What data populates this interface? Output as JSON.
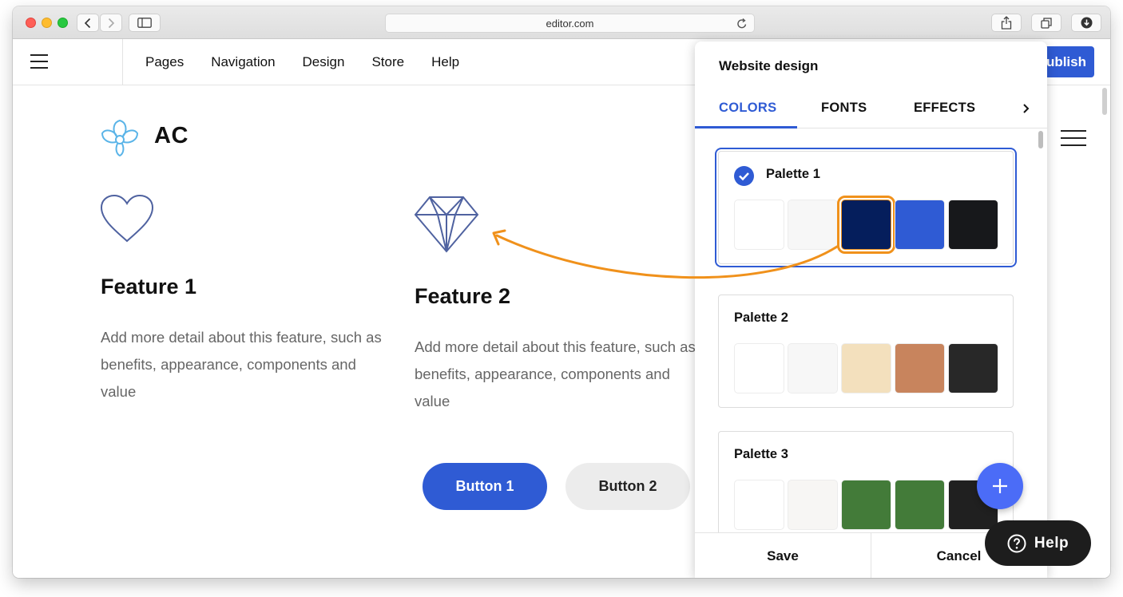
{
  "browser": {
    "url": "editor.com"
  },
  "topbar": {
    "menu": [
      "Pages",
      "Navigation",
      "Design",
      "Store",
      "Help"
    ],
    "publish_label": "ublish"
  },
  "site": {
    "logo_text": "AC",
    "features": [
      {
        "title": "Feature 1",
        "text": "Add more detail about this feature, such as benefits, appearance, components and value",
        "icon": "heart-icon"
      },
      {
        "title": "Feature 2",
        "text": "Add more detail about this feature, such as benefits, appearance, components and value",
        "icon": "diamond-icon"
      }
    ],
    "button1": "Button 1",
    "button2": "Button 2"
  },
  "panel": {
    "title": "Website design",
    "tabs": [
      "COLORS",
      "FONTS",
      "EFFECTS"
    ],
    "active_tab": "COLORS",
    "palettes": [
      {
        "name": "Palette 1",
        "selected": true,
        "colors": [
          "#ffffff",
          "#f7f7f7",
          "#051e5c",
          "#2f5bd4",
          "#17181b"
        ]
      },
      {
        "name": "Palette 2",
        "selected": false,
        "colors": [
          "#ffffff",
          "#f7f7f7",
          "#f3e0bd",
          "#c8845d",
          "#282828"
        ]
      },
      {
        "name": "Palette 3",
        "selected": false,
        "colors": [
          "#ffffff",
          "#f7f6f4",
          "#437b39",
          "#437b39",
          "#202020"
        ]
      }
    ],
    "highlighted_swatch": {
      "palette": 0,
      "index": 2
    },
    "save_label": "Save",
    "cancel_label": "Cancel"
  },
  "help_label": "Help",
  "colors": {
    "accent": "#2f5bd4",
    "annotation": "#f0911b",
    "fab": "#4b6cf7"
  }
}
